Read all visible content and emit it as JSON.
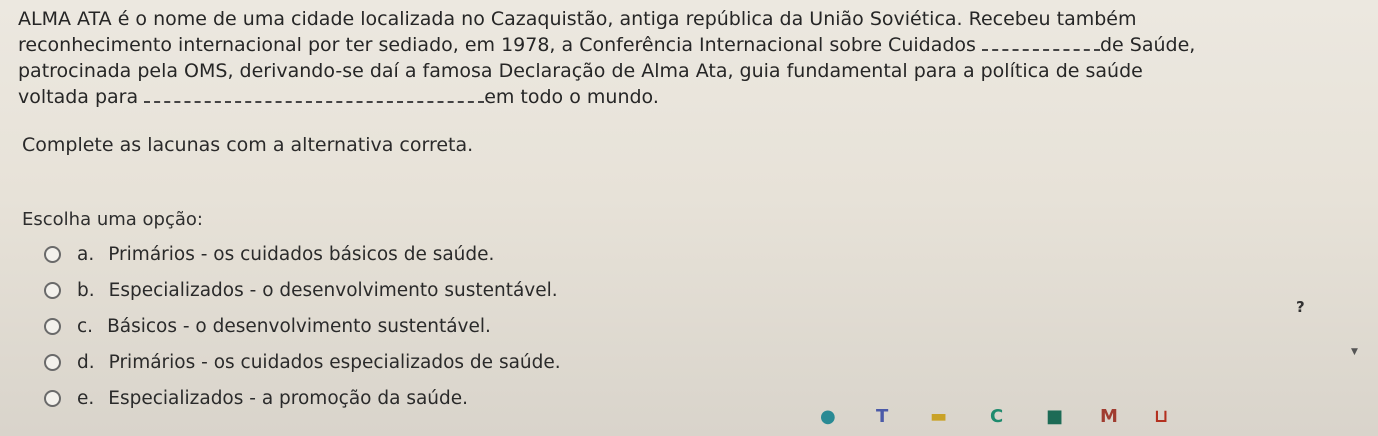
{
  "question": {
    "line1": "ALMA ATA é o nome de uma cidade localizada no Cazaquistão, antiga república da União Soviética. Recebeu também",
    "line2_before": "reconhecimento internacional por ter sediado, em 1978, a Conferência Internacional sobre Cuidados ",
    "line2_after": "de Saúde,",
    "line3": "patrocinada pela OMS, derivando-se daí a famosa Declaração de Alma Ata, guia fundamental para a política de saúde",
    "line4_before": "voltada para ",
    "line4_after": "em todo o mundo."
  },
  "instruction": "Complete as lacunas com a alternativa correta.",
  "prompt": "Escolha uma opção:",
  "options": [
    {
      "letter": "a.",
      "text": "Primários - os cuidados básicos de saúde."
    },
    {
      "letter": "b.",
      "text": "Especializados - o desenvolvimento sustentável."
    },
    {
      "letter": "c.",
      "text": "Básicos - o desenvolvimento sustentável."
    },
    {
      "letter": "d.",
      "text": "Primários - os cuidados especializados de saúde."
    },
    {
      "letter": "e.",
      "text": "Especializados - a promoção da saúde."
    }
  ],
  "help_label": "?",
  "taskbar": {
    "icons": [
      {
        "name": "app-icon-1",
        "glyph": "●",
        "color": "#2a8a94"
      },
      {
        "name": "teams-icon",
        "glyph": "T",
        "color": "#4b5aa8"
      },
      {
        "name": "folder-icon",
        "glyph": "▬",
        "color": "#c9a227"
      },
      {
        "name": "browser-icon",
        "glyph": "C",
        "color": "#1f8b6e"
      },
      {
        "name": "store-icon",
        "glyph": "■",
        "color": "#1d6b56"
      },
      {
        "name": "app-icon-2",
        "glyph": "M",
        "color": "#a03c30"
      },
      {
        "name": "mail-icon",
        "glyph": "⊔",
        "color": "#b3301f"
      }
    ]
  }
}
